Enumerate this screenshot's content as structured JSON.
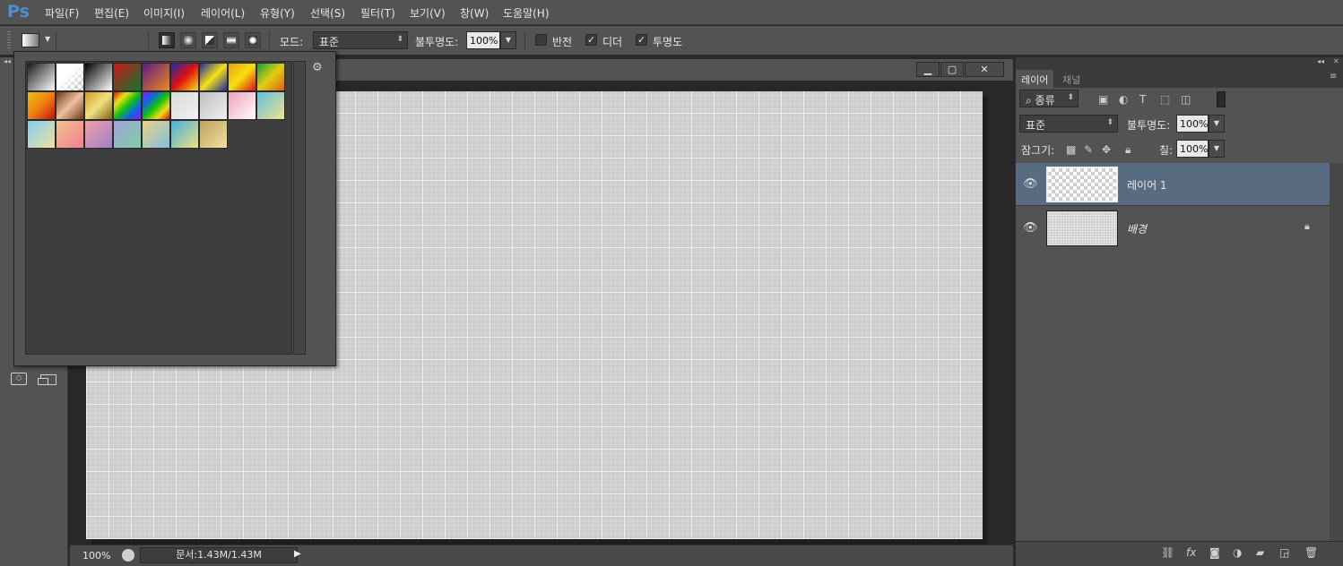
{
  "app": {
    "logo": "Ps"
  },
  "menu": {
    "items": [
      "파일(F)",
      "편집(E)",
      "이미지(I)",
      "레이어(L)",
      "유형(Y)",
      "선택(S)",
      "필터(T)",
      "보기(V)",
      "창(W)",
      "도움말(H)"
    ]
  },
  "options": {
    "mode_label": "모드:",
    "mode_value": "표준",
    "opacity_label": "불투명도:",
    "opacity_value": "100%",
    "reverse_label": "반전",
    "dither_label": "디더",
    "transparency_label": "투명도",
    "reverse_checked": false,
    "dither_checked": true,
    "transparency_checked": true
  },
  "gradient_picker": {
    "swatches": [
      "linear-gradient(135deg,#1a1a1a,#fff)",
      "linear-gradient(135deg,#fff,#fff 40%,rgba(255,255,255,0))",
      "linear-gradient(135deg,#000,#fff)",
      "linear-gradient(135deg,#d4141c,#0a7a2e)",
      "linear-gradient(135deg,#5a1a8a,#f08a1a)",
      "linear-gradient(135deg,#1a2aa8,#e01010,#f5e010)",
      "linear-gradient(135deg,#1a2aa8,#f5e010,#1a2aa8)",
      "linear-gradient(135deg,#e8a010,#f5e010,#e01010)",
      "linear-gradient(135deg,#10a040,#e0d010,#e06010)",
      "linear-gradient(135deg,#e8c010,#f08010,#c01010)",
      "linear-gradient(135deg,#6a3a1a,#f0c0a0,#6a3a1a)",
      "linear-gradient(135deg,#d0a020,#f0e080,#806010)",
      "linear-gradient(135deg,#e01010,#f0e010,#10c010,#1060f0,#a010f0)",
      "linear-gradient(135deg,#a010f0,#1060f0,#10c010,#f0e010,#e01010)",
      "linear-gradient(135deg,#dcdcdc,#f0f0f0)",
      "linear-gradient(135deg,#bfbfbf,#f0f0f0)",
      "linear-gradient(135deg,#f0a0b8,#fff)",
      "linear-gradient(135deg,#60c0e0,#f0e090)",
      "linear-gradient(135deg,#80d0f0,#f0e0a0)",
      "linear-gradient(135deg,#f0c090,#f08090)",
      "linear-gradient(135deg,#f0a0a0,#a080d0)",
      "linear-gradient(135deg,#a0a0e0,#80d0a0)",
      "linear-gradient(135deg,#f0d080,#80c0e0)",
      "linear-gradient(135deg,#40b0e0,#f0e080)",
      "linear-gradient(135deg,#c0a060,#f0e0a0)"
    ]
  },
  "document": {
    "zoom": "100%",
    "info": "문서:1.43M/1.43M"
  },
  "panel": {
    "tabs": [
      "레이어",
      "채널"
    ],
    "filter_label": "종류",
    "blend_mode": "표준",
    "opacity_label": "불투명도:",
    "opacity_value": "100%",
    "lock_label": "잠그기:",
    "fill_label": "칠:",
    "fill_value": "100%",
    "layers": [
      {
        "name": "레이어 1",
        "selected": true
      },
      {
        "name": "배경",
        "selected": false,
        "locked": true
      }
    ]
  }
}
